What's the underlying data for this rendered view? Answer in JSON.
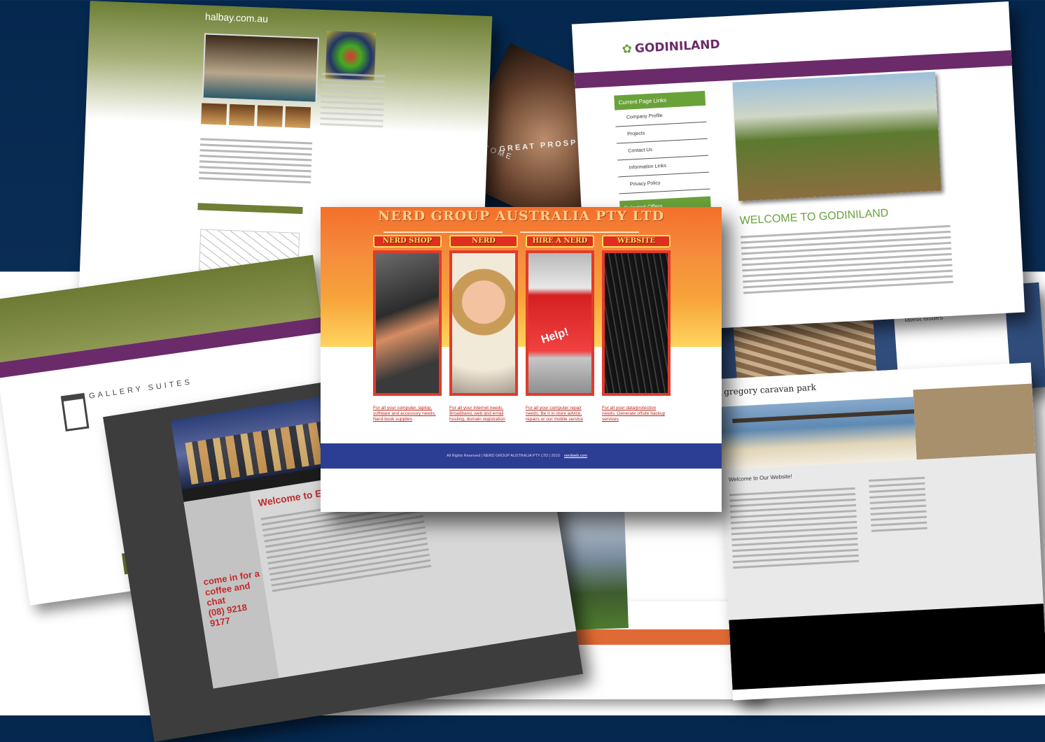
{
  "halbay": {
    "title": "halbay.com.au"
  },
  "godiniland": {
    "logo": "GODINILAND",
    "panel_title": "Current Page Links",
    "links": [
      "Company Profile",
      "Projects",
      "Contact Us",
      "Information Links",
      "Privacy Policy"
    ],
    "panel_title2": "Selected Offers",
    "welcome": "WELCOME TO GODINILAND"
  },
  "gallery": {
    "name": "GALLERY SUITES"
  },
  "coffee": {
    "welcome": "Welcome to E",
    "cta": "come in for a coffee and chat",
    "phone": "(08) 9218 9177"
  },
  "caravan": {
    "name": "gregory caravan park",
    "welcome": "Welcome to Our Website!"
  },
  "welcome_strip": {
    "text": "WELCOME",
    "text2": "GREAT PROSPECTS"
  },
  "navy_card": {
    "heading": "latest issues"
  },
  "nerd": {
    "title": "NERD GROUP AUSTRALIA PTY LTD",
    "panels": [
      {
        "label": "NERD SHOP",
        "desc": "For all your computer, laptop, software and accessory needs. Nerd-book supplies"
      },
      {
        "label": "NERD",
        "desc": "For all your internet needs. Broadband, web and email hosting, domain registration"
      },
      {
        "label": "HIRE A NERD",
        "desc": "For all your computer repair needs. Be it in-store advice, repairs or our mobile service"
      },
      {
        "label": "WEBSITE",
        "desc": "For all your data/protection needs. Generate offsite backup services"
      }
    ],
    "help_key": "Help!",
    "footer": "All Rights Reserved | NERD GROUP AUSTRALIA PTY LTD | 2010",
    "footer_link": "nerdweb.com"
  }
}
